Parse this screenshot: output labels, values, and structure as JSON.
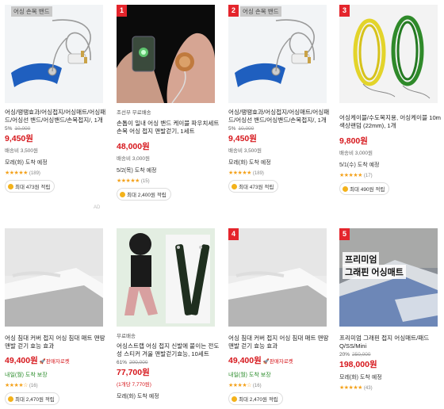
{
  "products": [
    {
      "tag": "어싱 손목 밴드",
      "title": "어싱/땡땡효과/어싱접지/어싱매트/어싱패드/어싱선 밴드/어싱밴드/손목접지/, 1개",
      "discount_pct": "5%",
      "orig_price": "10,000",
      "price": "9,450원",
      "shipping": "배송비 3,500원",
      "delivery": "모레(화) 도착 예정",
      "reviews": "(189)",
      "reward": "최대 473원 적립",
      "rating": 4.5
    },
    {
      "rank": "1",
      "seller": "조선부 무료배송",
      "title": "손톱이 일내 어싱 밴드 케이블 파우치세트 손목 어싱 접지 맨발걷기, 1세트",
      "price": "48,000원",
      "shipping": "배송비 3,000원",
      "delivery": "5/2(목) 도착 예정",
      "reviews": "(15)",
      "reward": "최대 2,400원 적립",
      "rating": 5
    },
    {
      "rank": "2",
      "tag": "어싱 손목 밴드",
      "title": "어싱/땡땡효과/어싱접지/어싱매트/어싱패드/어싱선 밴드/어싱밴드/손목접지/, 1개",
      "discount_pct": "5%",
      "orig_price": "10,000",
      "price": "9,450원",
      "shipping": "배송비 3,500원",
      "delivery": "모레(화) 도착 예정",
      "reviews": "(189)",
      "reward": "최대 473원 적립",
      "rating": 4.5
    },
    {
      "rank": "3",
      "title": "어싱케이블/수도목지용, 어싱케이블 10m 색상랜덤 (22mm), 1개",
      "price": "9,800원",
      "shipping": "배송비 3,000원",
      "delivery": "5/1(수) 도착 예정",
      "reviews": "(17)",
      "reward": "최대 490원 적립",
      "rating": 4.5
    },
    {
      "title": "어싱 침대 커버 접지 어싱 침대 매트 맨땅 맨발 걷기 효능 효과",
      "price": "49,400원",
      "rocket": "판매자로켓",
      "delivery": "내일(월) 도착 보장",
      "reviews": "(16)",
      "reward": "최대 2,470원 적립",
      "rating": 4
    },
    {
      "seller": "무료배송",
      "title": "어싱스트랩 어싱 접지 신발에 붙이는 전도성 스티커 겨울 맨발걷기효능, 10세트",
      "discount_pct": "61%",
      "orig_price": "200,000",
      "price": "77,700원",
      "shipping": "(1개당 7,770원)",
      "delivery": "모레(화) 도착 예정",
      "rating": 0
    },
    {
      "rank": "4",
      "title": "어싱 침대 커버 접지 어싱 침대 매트 맨땅 맨발 걷기 효능 효과",
      "price": "49,400원",
      "rocket": "판매자로켓",
      "delivery": "내일(월) 도착 보장",
      "reviews": "(16)",
      "reward": "최대 2,470원 적립",
      "rating": 4
    },
    {
      "rank": "5",
      "title": "프리미엄 그래핀 접지 어싱매트/패드 Q/SS/Mini",
      "discount_pct": "20%",
      "orig_price": "250,000",
      "price": "198,000원",
      "delivery": "모레(화) 도착 예정",
      "reviews": "(43)",
      "rating": 4.5,
      "image_text_1": "프리미엄",
      "image_text_2": "그래핀 어싱매트"
    }
  ],
  "ad_label": "AD"
}
